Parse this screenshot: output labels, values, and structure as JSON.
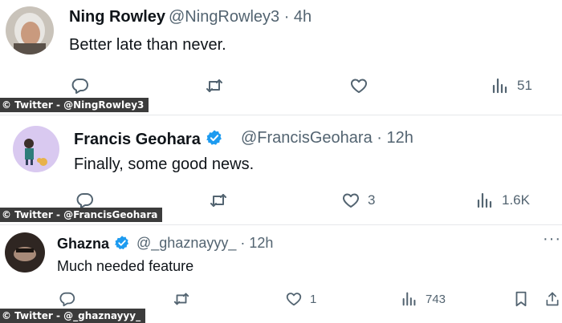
{
  "tweets": [
    {
      "name": "Ning Rowley",
      "verified": false,
      "handle": "@NingRowley3",
      "time": "4h",
      "text": "Better late than never.",
      "stats": {
        "replies": "",
        "reposts": "",
        "likes": "",
        "views": "51"
      },
      "credit": "© Twitter - @NingRowley3"
    },
    {
      "name": "Francis Geohara",
      "verified": true,
      "handle": "@FrancisGeohara",
      "time": "12h",
      "text": "Finally, some good news.",
      "stats": {
        "replies": "",
        "reposts": "",
        "likes": "3",
        "views": "1.6K"
      },
      "credit": "© Twitter - @FrancisGeohara"
    },
    {
      "name": "Ghazna",
      "verified": true,
      "handle": "@_ghaznayyy_",
      "time": "12h",
      "text": "Much needed feature",
      "stats": {
        "replies": "",
        "reposts": "",
        "likes": "1",
        "views": "743"
      },
      "credit": "© Twitter - @_ghaznayyy_"
    }
  ],
  "separator": " · ",
  "colors": {
    "verified": "#1d9bf0",
    "muted": "#536471",
    "credit_bg": "#3c3c3c"
  },
  "icons": [
    "reply-icon",
    "repost-icon",
    "like-icon",
    "views-icon",
    "bookmark-icon",
    "share-icon"
  ]
}
